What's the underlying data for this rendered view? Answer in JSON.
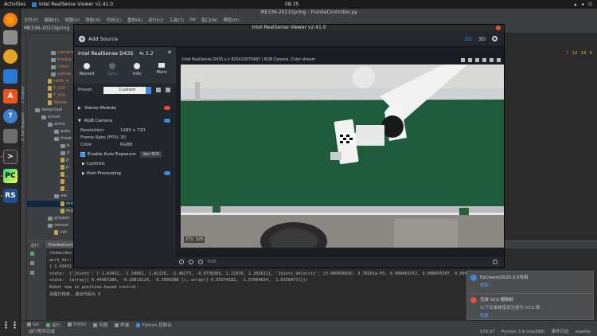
{
  "topbar": {
    "activities": "Activities",
    "app_name": "Intel RealSense Viewer v2.41.0",
    "clock": "08:35"
  },
  "pycharm": {
    "title": "ME336-2021Spring - FrankaController.py",
    "menu": [
      "文件(F)",
      "编辑(E)",
      "视图(V)",
      "导航(N)",
      "代码(C)",
      "重构(R)",
      "运行(U)",
      "工具(T)",
      "Git",
      "窗口(W)",
      "帮助(H)"
    ],
    "project_name": "ME336-2021Spring",
    "side_labels": [
      "1: Project",
      "2: Pull Requests"
    ],
    "tree": [
      "camera",
      "franka",
      "robot",
      "yellow",
      "calib_e",
      "T_b2l",
      "T_b2t",
      "Yellow",
      "deepclaw",
      "driver",
      "arms",
      "auto",
      "frank",
      "b",
      "d",
      "p",
      "p",
      "_",
      "",
      "_",
      "aw",
      "Arm",
      "Aub",
      "gripper",
      "sensor",
      "init"
    ],
    "editor_status": [
      "2",
      "12",
      "19",
      "6"
    ],
    "run_tab_label": "运行:",
    "run_tab_name": "FrankaCont",
    "console_lines": [
      "/home/dev",
      "work_dir:",
      "[-1.43431",
      "state:  {'Joints': [-1.43431, -1.54062, 1.42158, -2.48273, -0.0738389, 2.22976, 2.265611], 'Joints_Velocity': [0.000996692, 9.76161e-05, 0.000401972, 0.000695507, 0.000",
      "state:  (array([ 0.44987286, -0.10813124,  0.3999398 ]), array([ 0.55374182, -1.57064654,  1.01584771]))",
      "Robot now in position-based control.",
      "",
      "进程已结束, 退出代码为 0"
    ],
    "notifications": [
      {
        "title": "PyCharm2020.3.5可用",
        "body": "",
        "link": "更新..."
      },
      {
        "title": "无效 VCS 根映射",
        "body": "以下目录被错误注册为 VCS 根...",
        "link": "配置..."
      }
    ],
    "toolwindows": [
      "Git",
      "运行",
      "TODO",
      "问题",
      "终端",
      "Python 控制台"
    ],
    "status_left": "运行程序完成",
    "status_right": [
      "179:37",
      "Python 3.6 (me336)",
      "事件日志",
      "master"
    ]
  },
  "realsense": {
    "title": "Intel RealSense Viewer v2.41.0",
    "add_source": "Add Source",
    "device_name": "Intel RealSense D435",
    "usb": "3.2",
    "buttons": [
      {
        "label": "Record",
        "enabled": true
      },
      {
        "label": "Sync",
        "enabled": false
      },
      {
        "label": "Info",
        "enabled": true
      },
      {
        "label": "More",
        "enabled": true
      }
    ],
    "preset_label": "Preset:",
    "preset_value": "Custom",
    "stereo_module": "Stereo Module",
    "rgb_camera": "RGB Camera",
    "props": [
      {
        "label": "Resolution:",
        "value": "1280 x 720"
      },
      {
        "label": "Frame Rate (FPS):",
        "value": "30"
      },
      {
        "label": "Color",
        "value": "RGB8"
      }
    ],
    "auto_exposure": "Enable Auto Exposure",
    "set_roi": "Set ROI",
    "controls": "Controls",
    "post_processing": "Post-Processing",
    "view_2d": "2D",
    "view_3d": "3D",
    "stream_label": "Intel RealSense D435 s.n 825410070487 | RGB Camera, Color stream",
    "coords": "272, 325",
    "bottom_label": "RGB"
  },
  "colors": {
    "accent": "#1e9bff",
    "off_red": "#d9523f",
    "on_blue": "#3a8dde",
    "belt_green": "#1e5b3a"
  }
}
